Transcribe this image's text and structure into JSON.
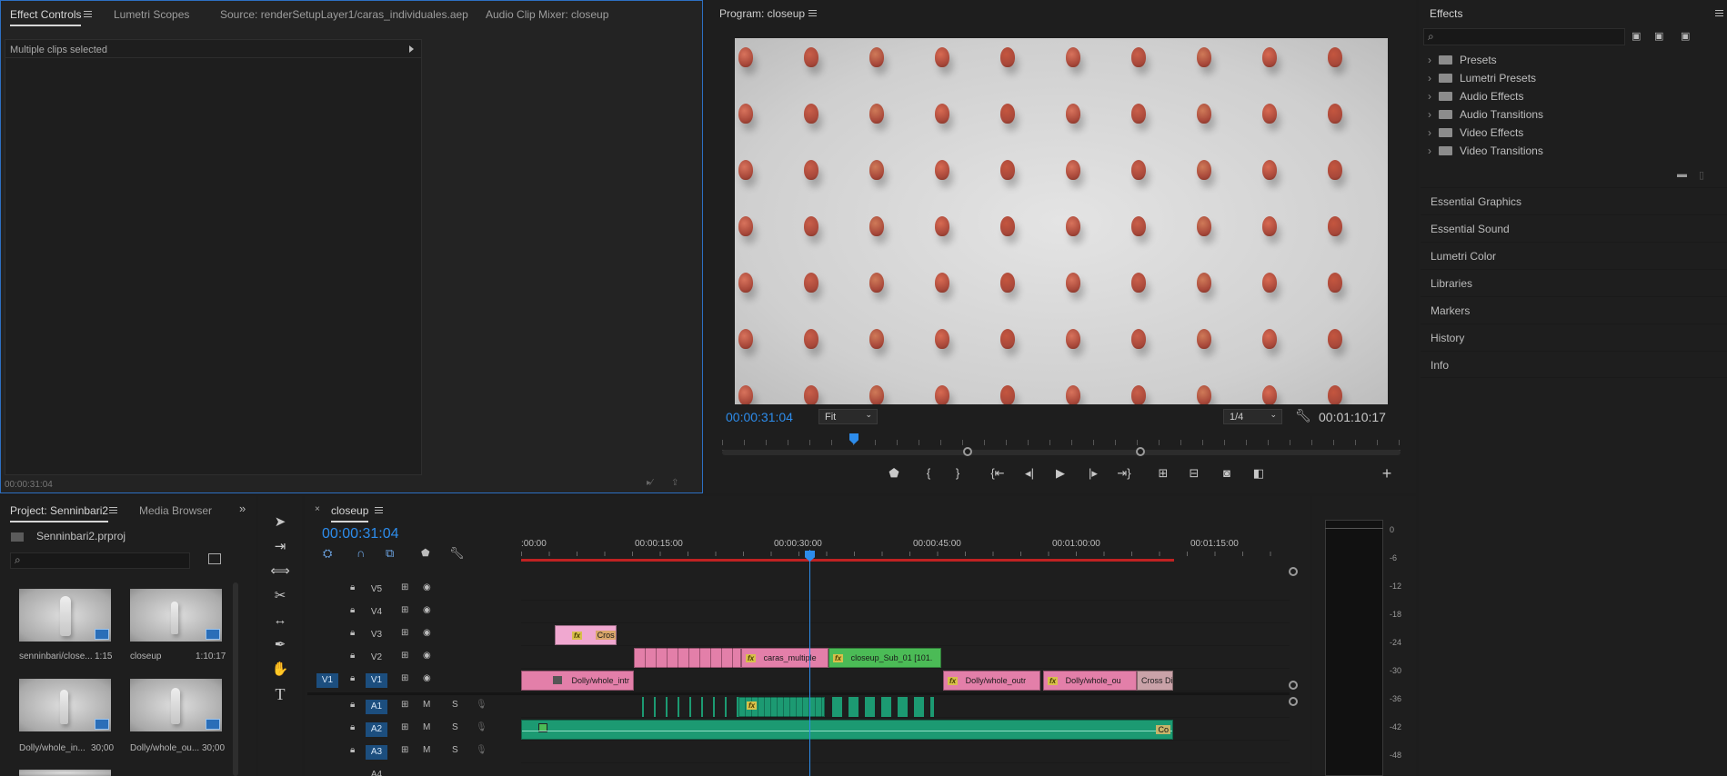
{
  "effect_controls": {
    "tabs": [
      "Effect Controls",
      "Lumetri Scopes",
      "Source: renderSetupLayer1/caras_individuales.aep",
      "Audio Clip Mixer: closeup"
    ],
    "message": "Multiple clips selected",
    "timecode": "00:00:31:04"
  },
  "program": {
    "title": "Program: closeup",
    "timecode_current": "00:00:31:04",
    "fit": "Fit",
    "resolution": "1/4",
    "timecode_duration": "00:01:10:17"
  },
  "effects": {
    "title": "Effects",
    "search_placeholder": "",
    "folders": [
      "Presets",
      "Lumetri Presets",
      "Audio Effects",
      "Audio Transitions",
      "Video Effects",
      "Video Transitions"
    ],
    "sections": [
      "Essential Graphics",
      "Essential Sound",
      "Lumetri Color",
      "Libraries",
      "Markers",
      "History",
      "Info"
    ]
  },
  "project": {
    "tabs": [
      "Project: Senninbari2",
      "Media Browser"
    ],
    "file": "Senninbari2.prproj",
    "items": [
      {
        "name": "senninbari/close...",
        "duration": "1:15"
      },
      {
        "name": "closeup",
        "duration": "1:10:17"
      },
      {
        "name": "Dolly/whole_in...",
        "duration": "30;00"
      },
      {
        "name": "Dolly/whole_ou...",
        "duration": "30;00"
      }
    ]
  },
  "timeline": {
    "tab": "closeup",
    "timecode": "00:00:31:04",
    "ruler": [
      ":00:00",
      "00:00:15:00",
      "00:00:30:00",
      "00:00:45:00",
      "00:01:00:00",
      "00:01:15:00"
    ],
    "video_tracks": [
      "V5",
      "V4",
      "V3",
      "V2",
      "V1"
    ],
    "audio_tracks": [
      "A1",
      "A2",
      "A3",
      "A4"
    ],
    "source_patch": "V1",
    "clips": {
      "v3_end": "Cros",
      "v2_a": "caras_multiple",
      "v2_b": "closeup_Sub_01 [101.",
      "v1_a": "Dolly/whole_intr",
      "v1_b": "Dolly/whole_outr",
      "v1_c": "Dolly/whole_ou",
      "v1_d": "Cross Dis",
      "a2_end": "Co"
    },
    "meter_scale": [
      "0",
      "-6",
      "-12",
      "-18",
      "-24",
      "-30",
      "-36",
      "-42",
      "-48"
    ]
  },
  "colors": {
    "accent": "#2d8ceb",
    "pink_clip": "#e37fa9",
    "green_clip": "#4bbb56",
    "audio_clip": "#1c9a72"
  }
}
